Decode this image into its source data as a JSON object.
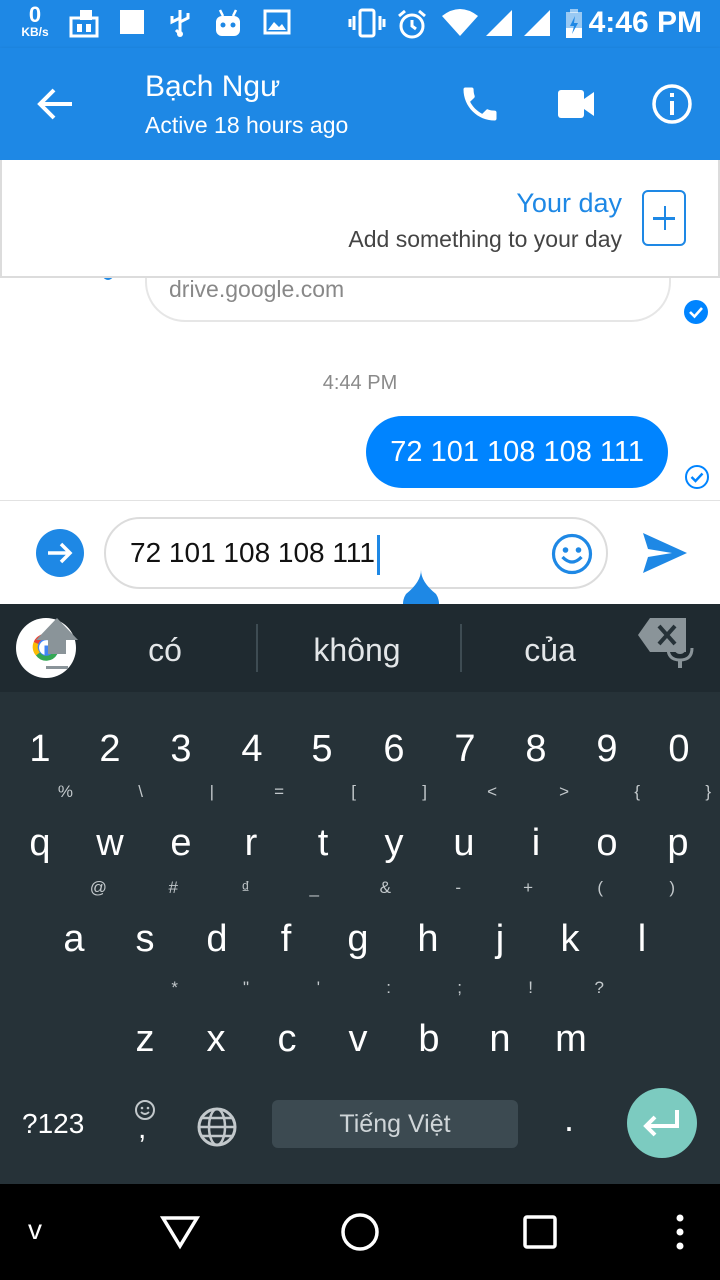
{
  "status_bar": {
    "net_speed_value": "0",
    "net_speed_unit": "KB/s",
    "time": "4:46 PM"
  },
  "header": {
    "contact_name": "Bạch Ngư",
    "contact_status": "Active 18 hours ago",
    "accent_color": "#1e88e5"
  },
  "your_day": {
    "title": "Your day",
    "subtitle": "Add something to your day"
  },
  "messages": {
    "link_preview_domain": "drive.google.com",
    "timestamp": "4:44 PM",
    "sent_message": "72 101 108 108 111",
    "bubble_color": "#0084ff"
  },
  "composer": {
    "input_value": "72 101 108 108 111"
  },
  "keyboard": {
    "suggestions": [
      "có",
      "không",
      "của"
    ],
    "number_row": [
      "1",
      "2",
      "3",
      "4",
      "5",
      "6",
      "7",
      "8",
      "9",
      "0"
    ],
    "row1": [
      "q",
      "w",
      "e",
      "r",
      "t",
      "y",
      "u",
      "i",
      "o",
      "p"
    ],
    "row1_hints": [
      "%",
      "\\",
      "|",
      "=",
      "[",
      "]",
      "<",
      ">",
      "{",
      "}"
    ],
    "row2": [
      "a",
      "s",
      "d",
      "f",
      "g",
      "h",
      "j",
      "k",
      "l"
    ],
    "row2_hints": [
      "@",
      "#",
      "₫",
      "_",
      "&",
      "-",
      "+",
      "(",
      ")"
    ],
    "row3": [
      "z",
      "x",
      "c",
      "v",
      "b",
      "n",
      "m"
    ],
    "row3_hints": [
      "*",
      "\"",
      "'",
      ":",
      ";",
      "!",
      "?"
    ],
    "symbols_key": "?123",
    "emoji_comma_key": ",",
    "space_label": "Tiếng Việt",
    "period_key": "."
  },
  "nav_bar": {
    "extra_button": "v"
  }
}
